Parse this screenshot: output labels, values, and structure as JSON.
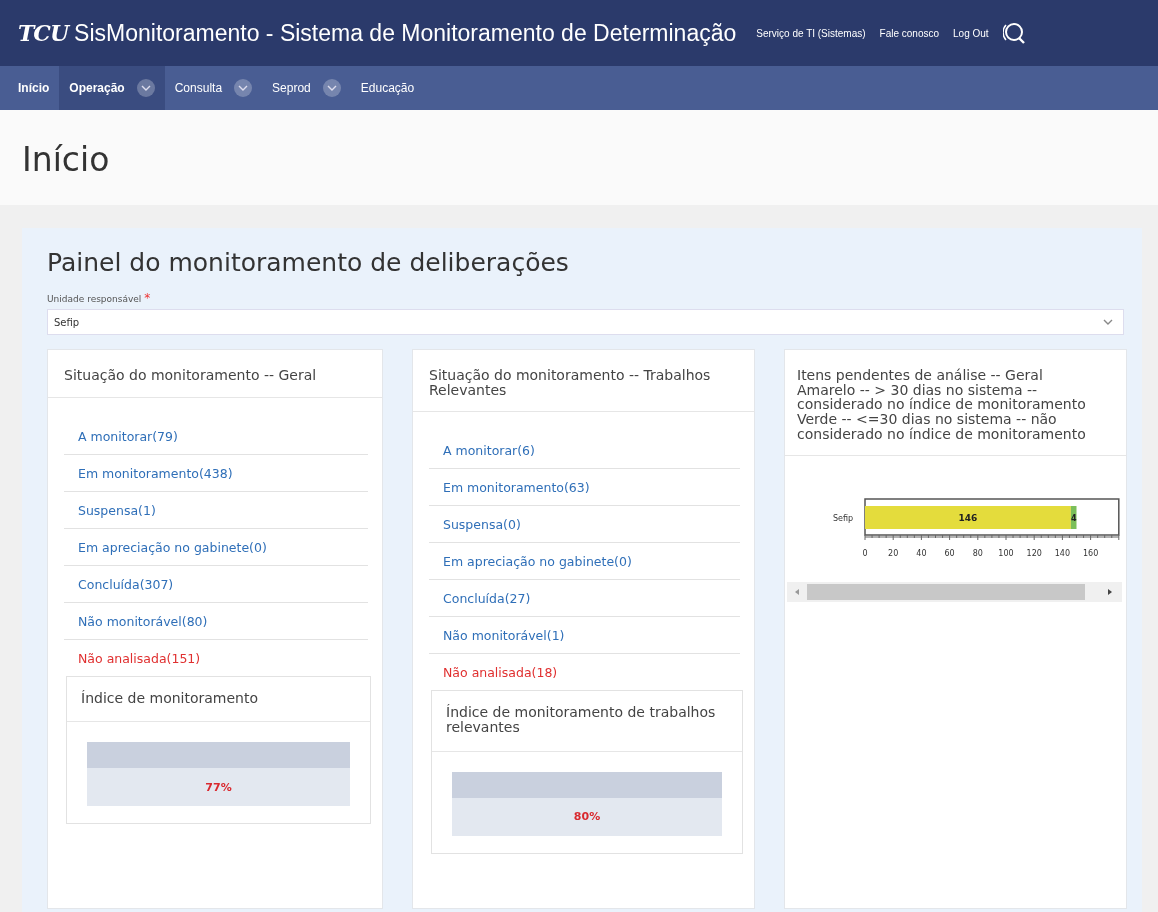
{
  "header": {
    "logo": "TCU",
    "title": "SisMonitoramento - Sistema de Monitoramento de Determinação",
    "links": [
      "Serviço de TI (Sistemas)",
      "Fale conosco",
      "Log Out"
    ]
  },
  "nav": [
    {
      "label": "Início",
      "bold": true,
      "highlighted": false,
      "dropdown": false
    },
    {
      "label": "Operação",
      "bold": true,
      "highlighted": true,
      "dropdown": true
    },
    {
      "label": "Consulta",
      "bold": false,
      "highlighted": false,
      "dropdown": true
    },
    {
      "label": "Seprod",
      "bold": false,
      "highlighted": false,
      "dropdown": true
    },
    {
      "label": "Educação",
      "bold": false,
      "highlighted": false,
      "dropdown": false
    }
  ],
  "page_title": "Início",
  "panel": {
    "title": "Painel do monitoramento de deliberações",
    "unit_field": {
      "label": "Unidade responsável",
      "required_mark": "*",
      "value": "Sefip"
    },
    "cards": [
      {
        "kind": "status",
        "title": "Situação do monitoramento -- Geral",
        "items": [
          {
            "label": "A monitorar(79)",
            "alert": false
          },
          {
            "label": "Em monitoramento(438)",
            "alert": false
          },
          {
            "label": "Suspensa(1)",
            "alert": false
          },
          {
            "label": "Em apreciação no gabinete(0)",
            "alert": false
          },
          {
            "label": "Concluída(307)",
            "alert": false
          },
          {
            "label": "Não monitorável(80)",
            "alert": false
          },
          {
            "label": "Não analisada(151)",
            "alert": true
          }
        ],
        "index": {
          "title": "Índice de monitoramento",
          "value": "77%"
        }
      },
      {
        "kind": "status",
        "title": "Situação do monitoramento -- Trabalhos Relevantes",
        "items": [
          {
            "label": "A monitorar(6)",
            "alert": false
          },
          {
            "label": "Em monitoramento(63)",
            "alert": false
          },
          {
            "label": "Suspensa(0)",
            "alert": false
          },
          {
            "label": "Em apreciação no gabinete(0)",
            "alert": false
          },
          {
            "label": "Concluída(27)",
            "alert": false
          },
          {
            "label": "Não monitorável(1)",
            "alert": false
          },
          {
            "label": "Não analisada(18)",
            "alert": true
          }
        ],
        "index": {
          "title": "Índice de monitoramento de trabalhos relevantes",
          "value": "80%"
        }
      },
      {
        "kind": "chart",
        "title_lines": [
          "Itens pendentes de análise -- Geral",
          "Amarelo -- > 30 dias no sistema -- considerado no índice de monitoramento",
          "Verde -- <=30 dias no sistema -- não considerado no índice de monitoramento"
        ],
        "chart_data": {
          "type": "bar",
          "orientation": "horizontal",
          "stacked": true,
          "categories": [
            "Sefip"
          ],
          "series": [
            {
              "color": "#e4dc3c",
              "values": [
                146
              ]
            },
            {
              "color": "#7bbf5a",
              "values": [
                4
              ]
            }
          ],
          "xlim": [
            0,
            180
          ],
          "xticks": [
            0,
            20,
            40,
            60,
            80,
            100,
            120,
            140,
            160
          ],
          "data_labels": true
        }
      }
    ]
  }
}
